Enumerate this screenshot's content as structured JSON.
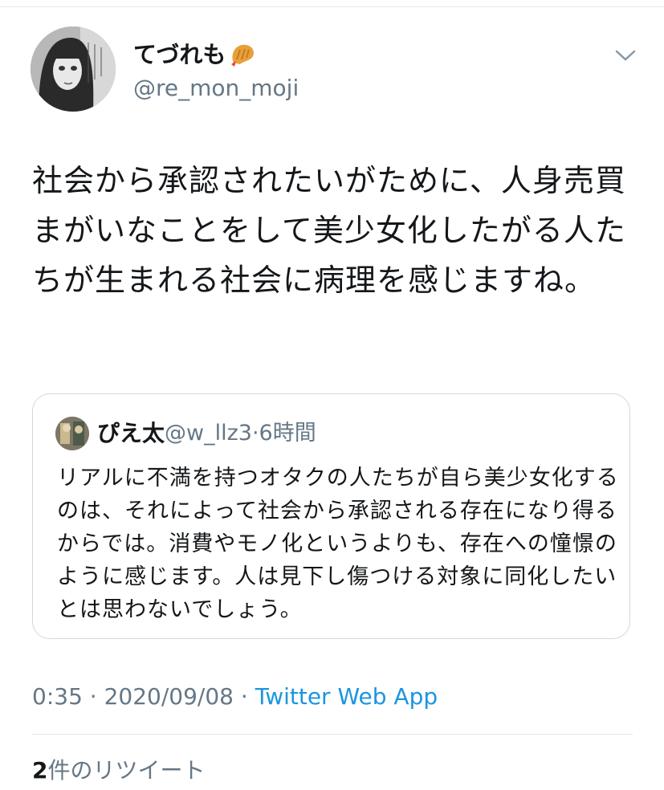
{
  "tweet": {
    "display_name": "てづれも",
    "name_emoji_icon": "fried-shrimp-icon",
    "handle": "@re_mon_moji",
    "text": "社会から承認されたいがために、人身売買まがいなことをして美少女化したがる人たちが生まれる社会に病理を感じますね。",
    "time": "0:35",
    "date": "2020/09/08",
    "source": "Twitter Web App",
    "separator": "·"
  },
  "quoted": {
    "display_name": "ぴえ太",
    "handle": "@w_llz3",
    "separator": "·",
    "time_ago": "6時間",
    "text": "リアルに不満を持つオタクの人たちが自ら美少女化するのは、それによって社会から承認される存在になり得るからでは。消費やモノ化というよりも、存在への憧憬のように感じます。人は見下し傷つける対象に同化したいとは思わないでしょう。"
  },
  "stats": {
    "retweet_count": "2",
    "retweet_label": "件のリツイート"
  },
  "colors": {
    "text": "#14171a",
    "secondary": "#657786",
    "link": "#1b95e0",
    "border": "#cfd9de"
  }
}
